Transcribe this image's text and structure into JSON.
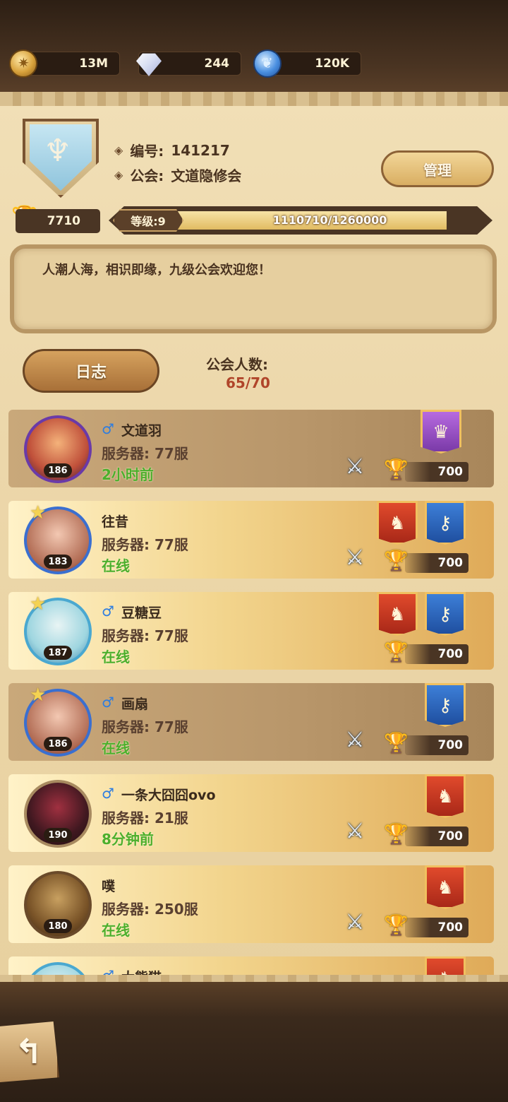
{
  "resources": {
    "gold": "13M",
    "diamonds": "244",
    "runes": "120K"
  },
  "guild": {
    "id_label": "编号:",
    "id_value": "141217",
    "name_label": "公会:",
    "name_value": "文道隐修会",
    "manage_label": "管理",
    "trophies": "7710",
    "level_label": "等级:9",
    "xp_text": "1110710/1260000",
    "xp_progress": 0.881,
    "notice": "人潮人海，相识即缘，九级公会欢迎您！",
    "log_label": "日志",
    "member_count_label": "公会人数:",
    "member_count_value": "65/70"
  },
  "members": [
    {
      "name": "文道羽",
      "server": "服务器: 77服",
      "status": "2小时前",
      "level": "186",
      "score": "700",
      "male": true,
      "icon": "jester-avatar"
    },
    {
      "name": "往昔",
      "server": "服务器: 77服",
      "status": "在线",
      "level": "183",
      "score": "700",
      "male": false,
      "icon": "pink-hair-avatar"
    },
    {
      "name": "豆糖豆",
      "server": "服务器: 77服",
      "status": "在线",
      "level": "187",
      "score": "700",
      "male": true,
      "icon": "teal-hair-avatar"
    },
    {
      "name": "画扇",
      "server": "服务器: 77服",
      "status": "在线",
      "level": "186",
      "score": "700",
      "male": true,
      "icon": "fox-girl-avatar"
    },
    {
      "name": "一条大囧囧ovo",
      "server": "服务器: 21服",
      "status": "8分钟前",
      "level": "190",
      "score": "700",
      "male": true,
      "icon": "dark-knight-avatar"
    },
    {
      "name": "噗",
      "server": "服务器: 250服",
      "status": "在线",
      "level": "180",
      "score": "700",
      "male": false,
      "icon": "dog-avatar"
    },
    {
      "name": "大熊猫",
      "server": "",
      "status": "",
      "level": "",
      "score": "",
      "male": true,
      "icon": "partial-avatar"
    }
  ]
}
